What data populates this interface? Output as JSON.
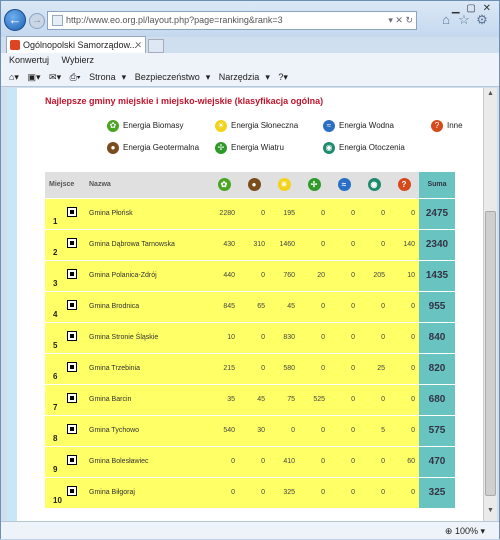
{
  "browser": {
    "url": "http://www.eo.org.pl/layout.php?page=ranking&rank=3",
    "tab_title": "Ogólnopolski Samorządow...",
    "favorites": [
      "Konwertuj",
      "Wybierz"
    ],
    "menu": [
      "Strona",
      "Bezpieczeństwo",
      "Narzędzia"
    ],
    "zoom": "100%"
  },
  "page": {
    "heading": "Najlepsze gminy miejskie i miejsko-wiejskie (klasyfikacja ogólna)",
    "legend": [
      {
        "label": "Energia Biomasy",
        "color": "#4aa523",
        "icon": "biomass-icon",
        "glyph": "✿"
      },
      {
        "label": "Energia Słoneczna",
        "color": "#f2d21a",
        "icon": "sun-icon",
        "glyph": "☀"
      },
      {
        "label": "Energia Wodna",
        "color": "#2a6fc4",
        "icon": "water-icon",
        "glyph": "≈"
      },
      {
        "label": "Inne",
        "color": "#d44a1b",
        "icon": "question-icon",
        "glyph": "?"
      },
      {
        "label": "Energia Geotermalna",
        "color": "#7a4d1e",
        "icon": "geothermal-icon",
        "glyph": "●"
      },
      {
        "label": "Energia Wiatru",
        "color": "#2f9a2a",
        "icon": "wind-icon",
        "glyph": "✢"
      },
      {
        "label": "Energia Otoczenia",
        "color": "#1f8a6e",
        "icon": "environment-icon",
        "glyph": "◉"
      }
    ],
    "table": {
      "col_place": "Miejsce",
      "col_name": "Nazwa",
      "col_sum": "Suma",
      "icon_cols": [
        {
          "icon": "biomass-icon",
          "color": "#4aa523",
          "glyph": "✿"
        },
        {
          "icon": "geothermal-icon",
          "color": "#7a4d1e",
          "glyph": "●"
        },
        {
          "icon": "sun-icon",
          "color": "#f2d21a",
          "glyph": "☀"
        },
        {
          "icon": "wind-icon",
          "color": "#2f9a2a",
          "glyph": "✢"
        },
        {
          "icon": "water-icon",
          "color": "#2a6fc4",
          "glyph": "≈"
        },
        {
          "icon": "environment-icon",
          "color": "#1f8a6e",
          "glyph": "◉"
        },
        {
          "icon": "question-icon",
          "color": "#d44a1b",
          "glyph": "?"
        }
      ],
      "rows": [
        {
          "place": "1",
          "name": "Gmina Płońsk",
          "vals": [
            "2280",
            "0",
            "195",
            "0",
            "0",
            "0",
            "0"
          ],
          "sum": "2475"
        },
        {
          "place": "2",
          "name": "Gmina Dąbrowa Tarnowska",
          "vals": [
            "430",
            "310",
            "1460",
            "0",
            "0",
            "0",
            "140"
          ],
          "sum": "2340"
        },
        {
          "place": "3",
          "name": "Gmina Polanica-Zdrój",
          "vals": [
            "440",
            "0",
            "760",
            "20",
            "0",
            "205",
            "10"
          ],
          "sum": "1435"
        },
        {
          "place": "4",
          "name": "Gmina Brodnica",
          "vals": [
            "845",
            "65",
            "45",
            "0",
            "0",
            "0",
            "0"
          ],
          "sum": "955"
        },
        {
          "place": "5",
          "name": "Gmina Stronie Śląskie",
          "vals": [
            "10",
            "0",
            "830",
            "0",
            "0",
            "0",
            "0"
          ],
          "sum": "840"
        },
        {
          "place": "6",
          "name": "Gmina Trzebinia",
          "vals": [
            "215",
            "0",
            "580",
            "0",
            "0",
            "25",
            "0"
          ],
          "sum": "820"
        },
        {
          "place": "7",
          "name": "Gmina Barcin",
          "vals": [
            "35",
            "45",
            "75",
            "525",
            "0",
            "0",
            "0"
          ],
          "sum": "680"
        },
        {
          "place": "8",
          "name": "Gmina Tychowo",
          "vals": [
            "540",
            "30",
            "0",
            "0",
            "0",
            "5",
            "0"
          ],
          "sum": "575"
        },
        {
          "place": "9",
          "name": "Gmina Bolesławiec",
          "vals": [
            "0",
            "0",
            "410",
            "0",
            "0",
            "0",
            "60"
          ],
          "sum": "470"
        },
        {
          "place": "10",
          "name": "Gmina Biłgoraj",
          "vals": [
            "0",
            "0",
            "325",
            "0",
            "0",
            "0",
            "0"
          ],
          "sum": "325"
        }
      ]
    }
  }
}
